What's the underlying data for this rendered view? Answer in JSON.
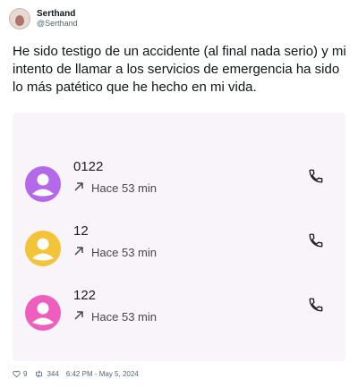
{
  "author": {
    "display_name": "Serthand",
    "handle": "@Serthand"
  },
  "tweet": {
    "text": "He sido testigo de un accidente (al final nada serio) y mi intento de llamar a los servicios de emergencia ha sido lo más patético que he hecho en mi vida."
  },
  "calls": [
    {
      "number": "0122",
      "time": "Hace 53 min",
      "avatar_color": "#b468ea"
    },
    {
      "number": "12",
      "time": "Hace 53 min",
      "avatar_color": "#f3c33a"
    },
    {
      "number": "122",
      "time": "Hace 53 min",
      "avatar_color": "#ee5fbd"
    }
  ],
  "footer": {
    "likes": "9",
    "retweets": "344",
    "timestamp": "6:42 PM - May 5, 2024"
  },
  "colors": {
    "card_bg": "#f9f4fa",
    "phone_icon": "#1c1b1f"
  },
  "icons": {
    "call_direction": "outgoing-arrow-icon",
    "call_action": "phone-icon",
    "like": "heart-icon",
    "retweet": "retweet-icon"
  }
}
